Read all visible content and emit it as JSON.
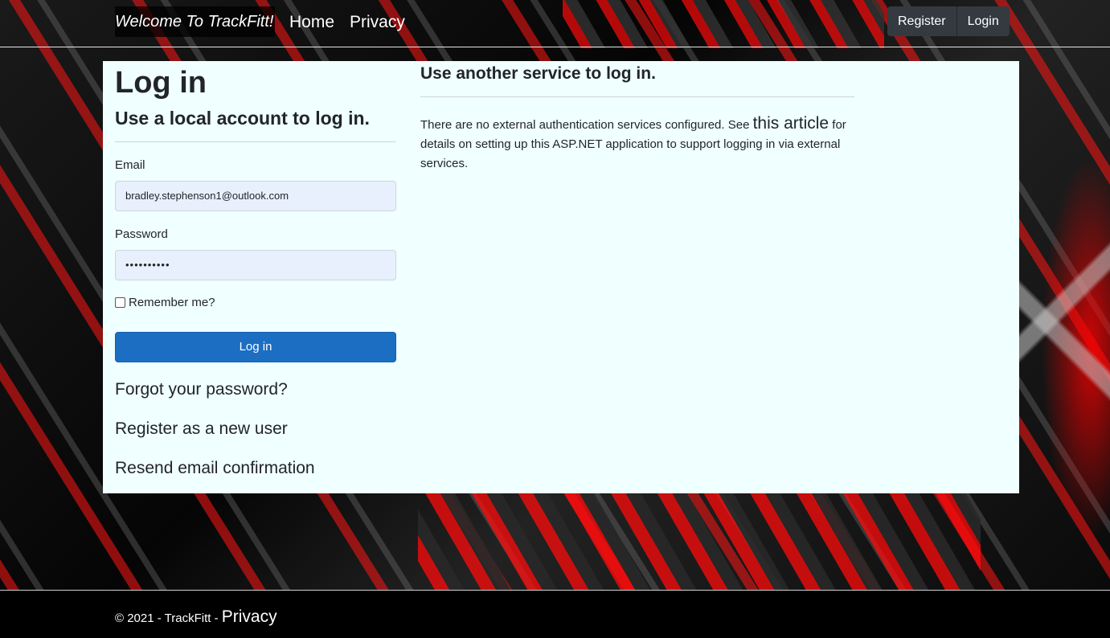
{
  "navbar": {
    "brand": "Welcome To TrackFitt!",
    "links": [
      "Home",
      "Privacy"
    ],
    "register": "Register",
    "login": "Login"
  },
  "login_form": {
    "title": "Log in",
    "subtitle": "Use a local account to log in.",
    "email_label": "Email",
    "email_value": "bradley.stephenson1@outlook.com",
    "password_label": "Password",
    "password_masked": "••••••••••",
    "remember_label": "Remember me?",
    "remember_checked": false,
    "submit_label": "Log in",
    "forgot_link": "Forgot your password?",
    "register_link": "Register as a new user",
    "resend_link": "Resend email confirmation"
  },
  "external": {
    "title": "Use another service to log in.",
    "text_before": "There are no external authentication services configured. See ",
    "link_text": "this article",
    "text_after": " for details on setting up this ASP.NET application to support logging in via external services."
  },
  "footer": {
    "copyright": "© 2021 - TrackFitt - ",
    "privacy_link": "Privacy"
  },
  "colors": {
    "panel_bg": "#f0ffff",
    "primary_button": "#1b6ec2",
    "nav_button": "#343a40",
    "autofill_bg": "#e8f0fe"
  }
}
